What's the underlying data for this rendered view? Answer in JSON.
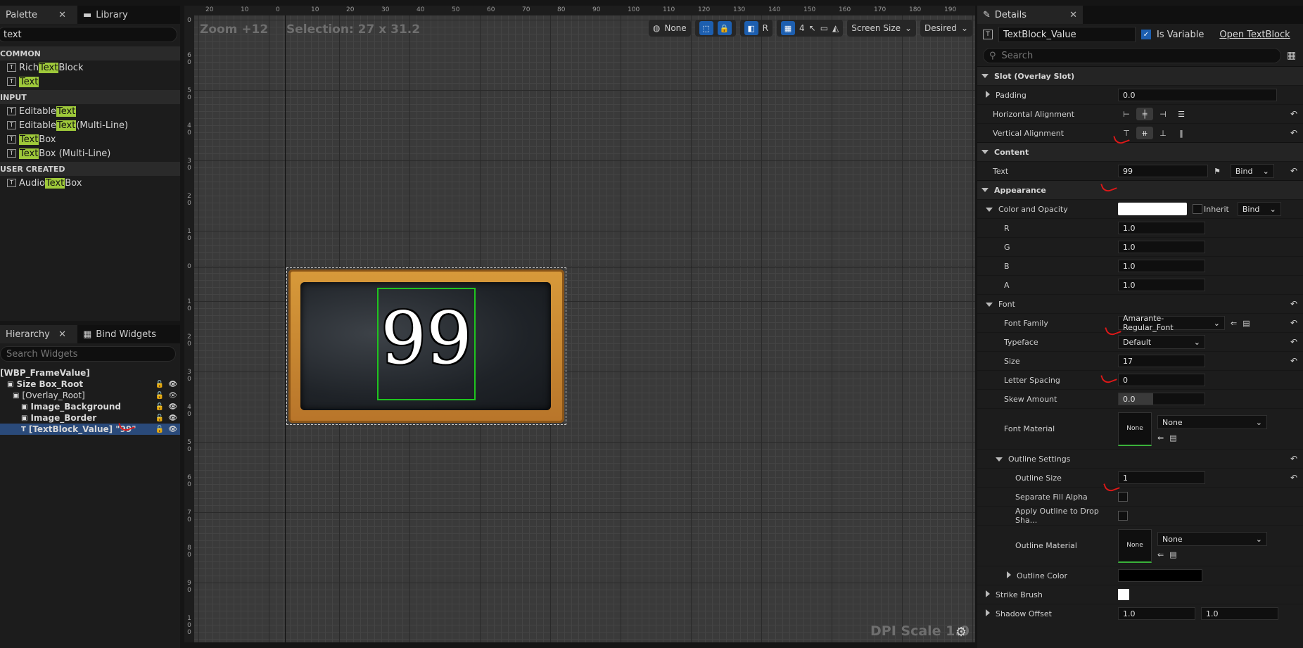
{
  "palette": {
    "tab_label": "Palette",
    "library_label": "Library",
    "search_value": "text",
    "categories": [
      {
        "name": "COMMON",
        "items": [
          {
            "pre": "Rich ",
            "hl": "Text",
            "post": " Block",
            "icon": "rich-text-icon"
          },
          {
            "pre": "",
            "hl": "Text",
            "post": "",
            "icon": "text-icon"
          }
        ]
      },
      {
        "name": "INPUT",
        "items": [
          {
            "pre": "Editable ",
            "hl": "Text",
            "post": "",
            "icon": "editable-text-icon"
          },
          {
            "pre": "Editable ",
            "hl": "Text",
            "post": " (Multi-Line)",
            "icon": "editable-text-multi-icon"
          },
          {
            "pre": "",
            "hl": "Text",
            "post": " Box",
            "icon": "text-box-icon"
          },
          {
            "pre": "",
            "hl": "Text",
            "post": " Box (Multi-Line)",
            "icon": "text-box-multi-icon"
          }
        ]
      },
      {
        "name": "USER CREATED",
        "items": [
          {
            "pre": "Audio ",
            "hl": "Text",
            "post": " Box",
            "icon": "audio-text-box-icon"
          }
        ]
      }
    ]
  },
  "hierarchy": {
    "tab_label": "Hierarchy",
    "bind_label": "Bind Widgets",
    "search_placeholder": "Search Widgets",
    "root": "[WBP_FrameValue]",
    "items": [
      {
        "label": "Size Box_Root",
        "indent": 10,
        "bold": true,
        "selected": false
      },
      {
        "label": "[Overlay_Root]",
        "indent": 18,
        "bold": false,
        "selected": false
      },
      {
        "label": "Image_Background",
        "indent": 30,
        "bold": true,
        "selected": false
      },
      {
        "label": "Image_Border",
        "indent": 30,
        "bold": true,
        "selected": false
      },
      {
        "label": "[TextBlock_Value] \"99\"",
        "indent": 30,
        "bold": true,
        "selected": true
      }
    ]
  },
  "viewport": {
    "zoom": "Zoom +12",
    "selection": "Selection: 27 x 31.2",
    "top_ruler": [
      "20",
      "10",
      "0",
      "10",
      "20",
      "30",
      "40",
      "50",
      "60",
      "70",
      "80",
      "90",
      "100",
      "110",
      "120",
      "130",
      "140",
      "150",
      "160",
      "170",
      "180",
      "190"
    ],
    "left_ruler": [
      "0",
      "6 0",
      "5 0",
      "4 0",
      "3 0",
      "2 0",
      "1 0",
      "0",
      "1 0",
      "2 0",
      "3 0",
      "4 0",
      "5 0",
      "6 0",
      "7 0",
      "8 0",
      "9 0",
      "1 0 0"
    ],
    "toolbar": {
      "world": "None",
      "r": "R",
      "grid": "4",
      "screen_size": "Screen Size",
      "desired": "Desired"
    },
    "dpi": "DPI Scale 1.0",
    "widget_text": "99"
  },
  "details": {
    "tab_label": "Details",
    "widget_name": "TextBlock_Value",
    "is_variable": "Is Variable",
    "open_link": "Open TextBlock",
    "search_placeholder": "Search",
    "sections": {
      "slot": "Slot (Overlay Slot)",
      "content": "Content",
      "appearance": "Appearance"
    },
    "props": {
      "padding": {
        "label": "Padding",
        "value": "0.0"
      },
      "h_align": "Horizontal Alignment",
      "v_align": "Vertical Alignment",
      "text": {
        "label": "Text",
        "value": "99",
        "bind": "Bind"
      },
      "color": {
        "label": "Color and Opacity",
        "inherit": "Inherit",
        "bind": "Bind"
      },
      "r": {
        "label": "R",
        "value": "1.0"
      },
      "g": {
        "label": "G",
        "value": "1.0"
      },
      "b": {
        "label": "B",
        "value": "1.0"
      },
      "a": {
        "label": "A",
        "value": "1.0"
      },
      "font": "Font",
      "font_family": {
        "label": "Font Family",
        "value": "Amarante-Regular_Font"
      },
      "typeface": {
        "label": "Typeface",
        "value": "Default"
      },
      "size": {
        "label": "Size",
        "value": "17"
      },
      "letter_spacing": {
        "label": "Letter Spacing",
        "value": "0"
      },
      "skew": {
        "label": "Skew Amount",
        "value": "0.0"
      },
      "font_material": {
        "label": "Font Material",
        "thumb": "None",
        "value": "None"
      },
      "outline": "Outline Settings",
      "outline_size": {
        "label": "Outline Size",
        "value": "1"
      },
      "sep_fill": "Separate Fill Alpha",
      "apply_outline": "Apply Outline to Drop Sha...",
      "outline_material": {
        "label": "Outline Material",
        "thumb": "None",
        "value": "None"
      },
      "outline_color": "Outline Color",
      "strike": "Strike Brush",
      "shadow_offset": {
        "label": "Shadow Offset",
        "x": "1.0",
        "y": "1.0"
      }
    }
  }
}
